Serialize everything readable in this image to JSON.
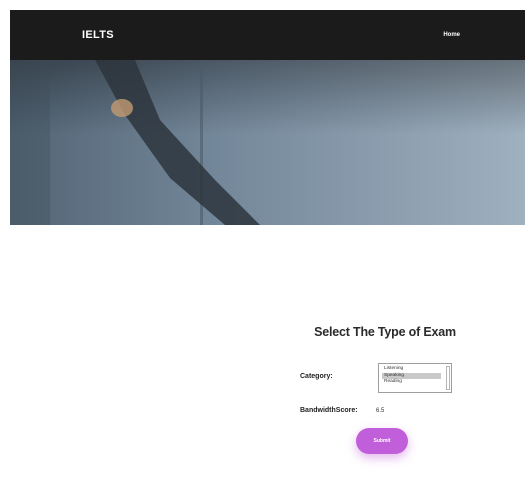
{
  "navbar": {
    "brand": "IELTS",
    "home_link": "Home"
  },
  "exam_form": {
    "title": "Select The Type of Exam",
    "category_label": "Category:",
    "category_options": [
      "Listening",
      "Speaking",
      "Reading"
    ],
    "category_selected": "Speaking",
    "bandwidth_label": "BandwidthScore:",
    "bandwidth_value": "6.5",
    "submit_label": "Submit"
  },
  "colors": {
    "navbar_bg": "#1b1b1b",
    "accent_button": "#c15fdb",
    "hero_tint": "#6f7f8e"
  }
}
